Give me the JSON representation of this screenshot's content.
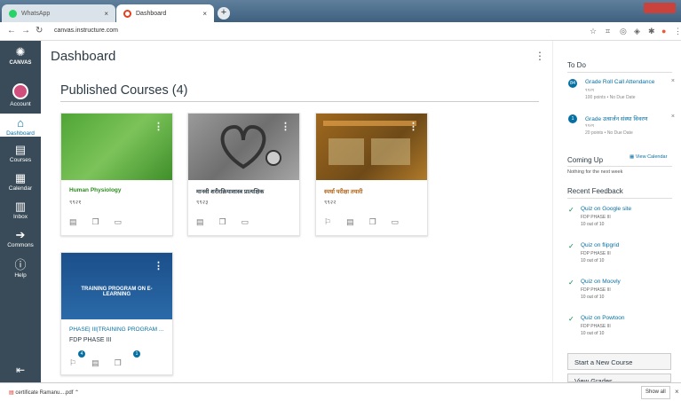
{
  "browser": {
    "tabs": [
      {
        "label": "WhatsApp",
        "color": "#25d366"
      },
      {
        "label": "Dashboard",
        "color": "#e2401c"
      }
    ],
    "url": "canvas.instructure.com"
  },
  "gnav": {
    "logo": "CANVAS",
    "items": [
      {
        "label": "Account",
        "icon": "account-icon"
      },
      {
        "label": "Dashboard",
        "icon": "dashboard-icon"
      },
      {
        "label": "Courses",
        "icon": "courses-icon"
      },
      {
        "label": "Calendar",
        "icon": "calendar-icon"
      },
      {
        "label": "Inbox",
        "icon": "inbox-icon"
      },
      {
        "label": "Commons",
        "icon": "commons-icon"
      },
      {
        "label": "Help",
        "icon": "help-icon"
      }
    ]
  },
  "main": {
    "title": "Dashboard",
    "section_title": "Published Courses (4)",
    "cards": [
      {
        "title": "Human Physiology",
        "code": "९९२१",
        "color": "#5fae3c",
        "title_color": "#2e8b20"
      },
      {
        "title": "मानवी शरीरक्रियाशास्त्र प्रात्यक्षिक",
        "code": "९९२३",
        "color": "#808080",
        "title_color": "#2d3b45"
      },
      {
        "title": "स्पर्धा परीक्षा तयारी",
        "code": "९९२२",
        "color": "#8a5a1e",
        "title_color": "#b0651a"
      },
      {
        "title": "PHASE| III|TRAINING PROGRAM ...",
        "code": "FDP PHASE III",
        "color": "#1b4f8a",
        "title_color": "#0770a3",
        "hero_text": "TRAINING PROGRAM ON E-LEARNING",
        "badge1": "4",
        "badge2": "1"
      }
    ]
  },
  "sidebar": {
    "todo_heading": "To Do",
    "todos": [
      {
        "badge": "84",
        "title": "Grade Roll Call Attendance",
        "code": "९९२१",
        "meta": "100 points • No Due Date"
      },
      {
        "badge": "1",
        "title": "Grade उत्सर्जन संस्था विवरण",
        "code": "९९२१",
        "meta": "20 points • No Due Date"
      }
    ],
    "coming_up": "Coming Up",
    "view_calendar": "View Calendar",
    "nothing": "Nothing for the next week",
    "recent_feedback": "Recent Feedback",
    "feedback": [
      {
        "title": "Quiz on Google site",
        "course": "FDP PHASE III",
        "score": "10 out of 10"
      },
      {
        "title": "Quiz on flipgrid",
        "course": "FDP PHASE III",
        "score": "10 out of 10"
      },
      {
        "title": "Quiz on Moovly",
        "course": "FDP PHASE III",
        "score": "10 out of 10"
      },
      {
        "title": "Quiz on Powtoon",
        "course": "FDP PHASE III",
        "score": "10 out of 10"
      }
    ],
    "start_course": "Start a New Course",
    "view_grades": "View Grades"
  },
  "downloads": {
    "file": "certificate Ramanu....pdf",
    "show_all": "Show all"
  }
}
